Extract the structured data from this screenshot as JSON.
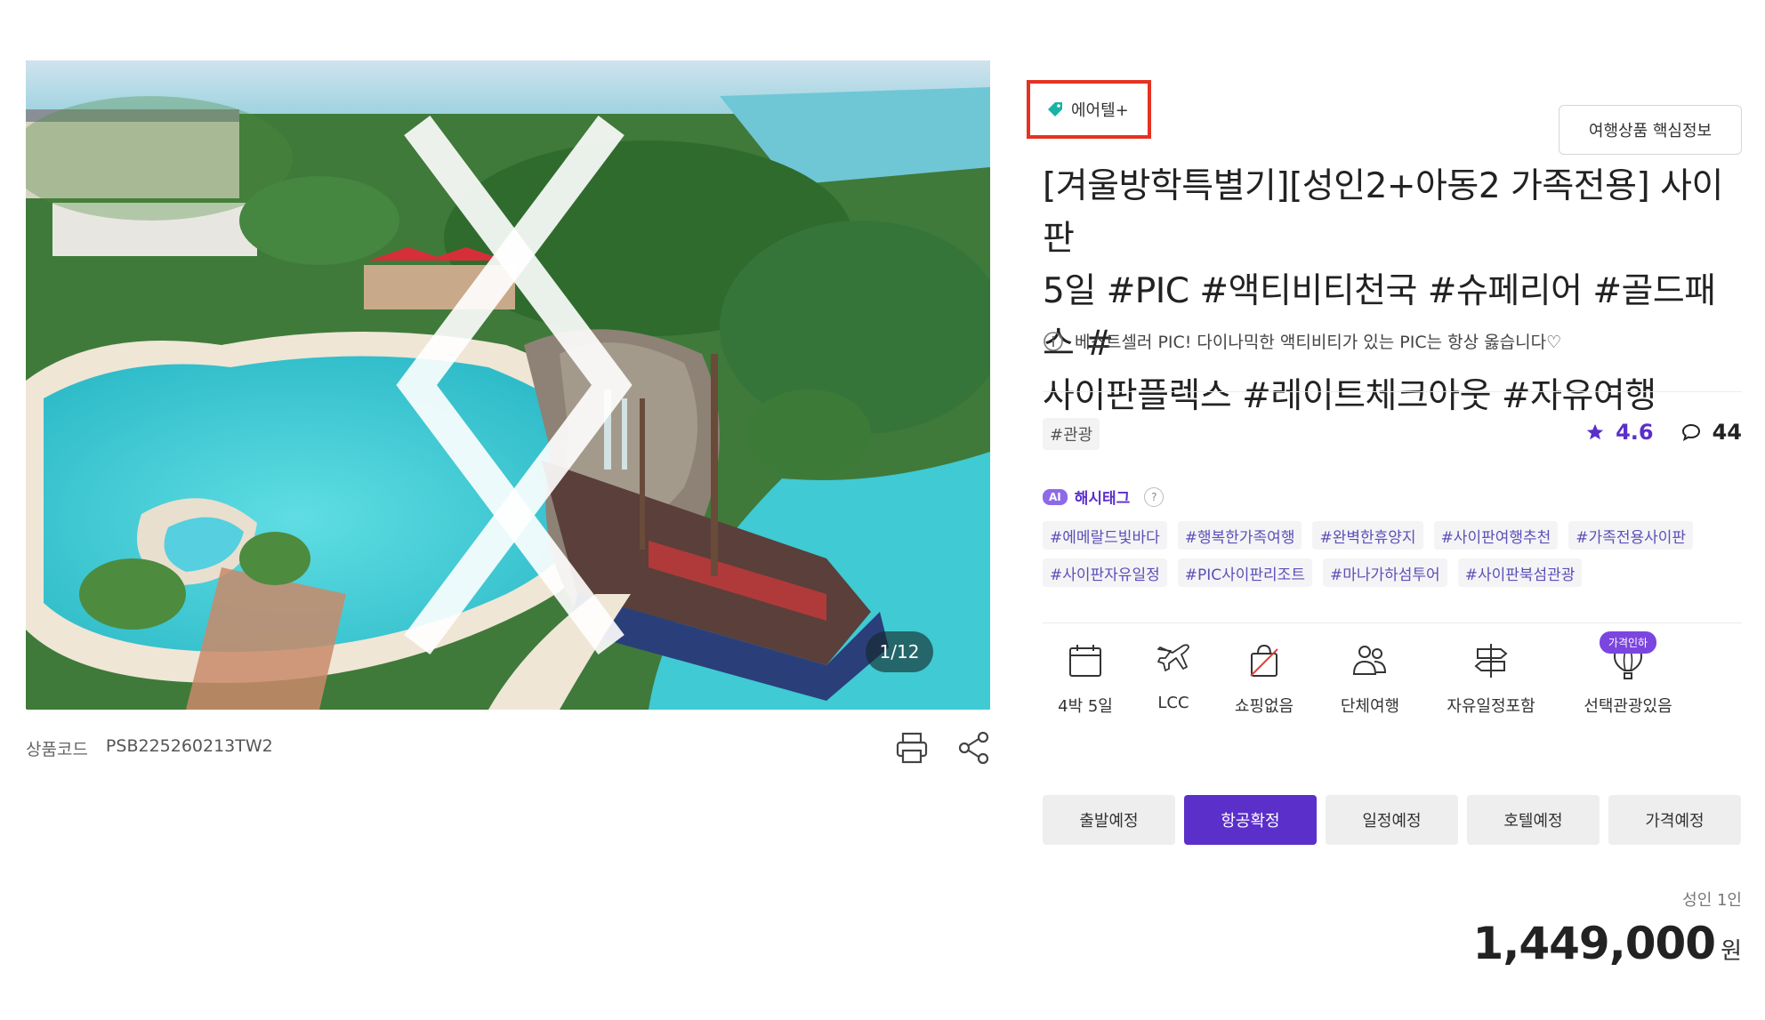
{
  "gallery": {
    "counter": "1/12",
    "image_alt": "aerial view of resort water park with pool and pirate ship"
  },
  "product": {
    "code_label": "상품코드",
    "code_value": "PSB225260213TW2"
  },
  "badge": {
    "label": "에어텔+",
    "icon": "tag-icon"
  },
  "key_info_button": "여행상품 핵심정보",
  "title_lines": [
    "[겨울방학특별기][성인2+아동2 가족전용] 사이판",
    "5일 #PIC #액티비티천국 #슈페리어 #골드패스 #",
    "사이판플렉스 #레이트체크아웃 #자유여행"
  ],
  "subtitle": "베스트셀러 PIC! 다이나믹한 액티비티가 있는 PIC는 항상 옳습니다♡",
  "category_tag": "#관광",
  "rating": {
    "score": "4.6",
    "review_count": "44"
  },
  "ai_hashtag": {
    "chip": "AI",
    "label": "해시태그",
    "help": "?"
  },
  "hashtags": [
    "#에메랄드빛바다",
    "#행복한가족여행",
    "#완벽한휴양지",
    "#사이판여행추천",
    "#가족전용사이판",
    "#사이판자유일정",
    "#PIC사이판리조트",
    "#마나가하섬투어",
    "#사이판북섬관광"
  ],
  "features": [
    {
      "label": "4박 5일",
      "icon": "calendar-icon"
    },
    {
      "label": "LCC",
      "icon": "airplane-icon"
    },
    {
      "label": "쇼핑없음",
      "icon": "no-shopping-icon"
    },
    {
      "label": "단체여행",
      "icon": "group-icon"
    },
    {
      "label": "자유일정포함",
      "icon": "signpost-icon"
    },
    {
      "label": "선택관광있음",
      "icon": "balloon-icon",
      "pill": "가격인하"
    }
  ],
  "status_tabs": [
    {
      "label": "출발예정",
      "active": false
    },
    {
      "label": "항공확정",
      "active": true
    },
    {
      "label": "일정예정",
      "active": false
    },
    {
      "label": "호텔예정",
      "active": false
    },
    {
      "label": "가격예정",
      "active": false
    }
  ],
  "price": {
    "per": "성인 1인",
    "amount": "1,449,000",
    "currency": "원"
  },
  "colors": {
    "accent": "#5b2fc9",
    "highlight_border": "#e53222",
    "badge_icon": "#19b3a5"
  }
}
